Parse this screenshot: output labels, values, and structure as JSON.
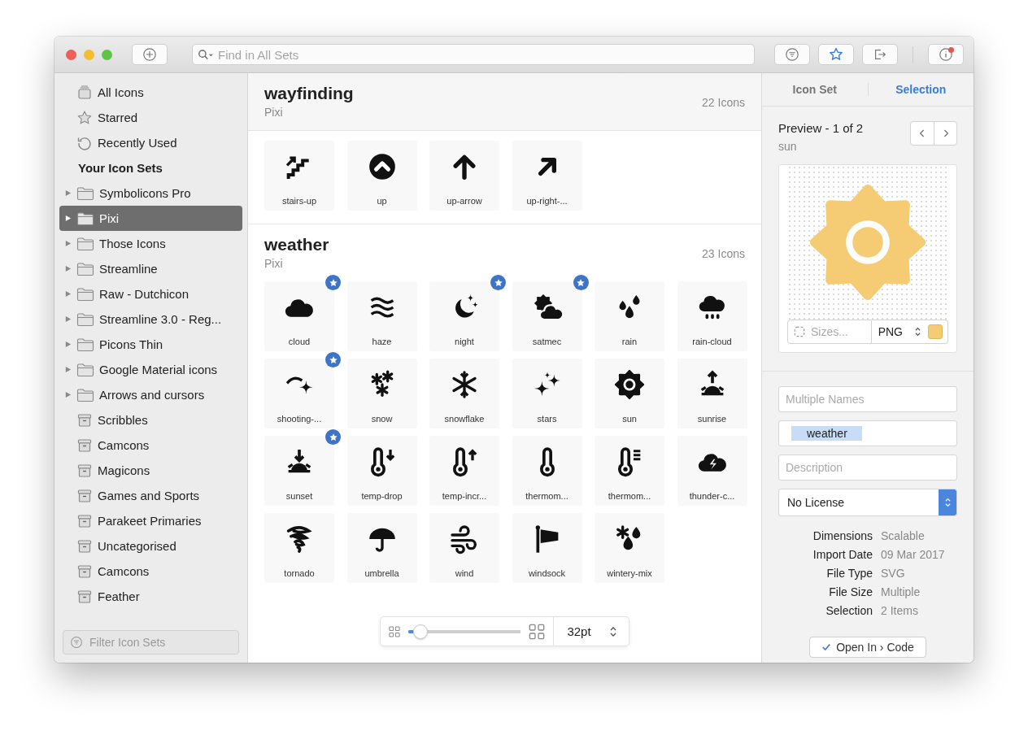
{
  "toolbar": {
    "search": {
      "placeholder": "Find in All Sets"
    },
    "notification": true
  },
  "sidebar": {
    "items": [
      {
        "label": "All Icons",
        "kind": "library",
        "selected": false
      },
      {
        "label": "Starred",
        "kind": "star",
        "selected": false
      },
      {
        "label": "Recently Used",
        "kind": "recent",
        "selected": false
      },
      {
        "label": "Your Icon Sets",
        "kind": "heading"
      },
      {
        "label": "Symbolicons Pro",
        "kind": "folder",
        "selected": false
      },
      {
        "label": "Pixi",
        "kind": "folder",
        "selected": true
      },
      {
        "label": "Those Icons",
        "kind": "folder",
        "selected": false
      },
      {
        "label": "Streamline",
        "kind": "folder",
        "selected": false
      },
      {
        "label": "Raw - Dutchicon",
        "kind": "folder",
        "selected": false
      },
      {
        "label": "Streamline 3.0 - Reg...",
        "kind": "folder",
        "selected": false
      },
      {
        "label": "Picons Thin",
        "kind": "folder",
        "selected": false
      },
      {
        "label": "Google Material icons",
        "kind": "folder",
        "selected": false
      },
      {
        "label": "Arrows and cursors",
        "kind": "folder",
        "selected": false
      },
      {
        "label": "Scribbles",
        "kind": "archive",
        "selected": false
      },
      {
        "label": "Camcons",
        "kind": "archive",
        "selected": false
      },
      {
        "label": "Magicons",
        "kind": "archive",
        "selected": false
      },
      {
        "label": "Games and Sports",
        "kind": "archive",
        "selected": false
      },
      {
        "label": "Parakeet Primaries",
        "kind": "archive",
        "selected": false
      },
      {
        "label": "Uncategorised",
        "kind": "archive",
        "selected": false
      },
      {
        "label": "Camcons",
        "kind": "archive",
        "selected": false
      },
      {
        "label": "Feather",
        "kind": "archive",
        "selected": false
      }
    ],
    "filter": {
      "placeholder": "Filter Icon Sets"
    }
  },
  "sections": [
    {
      "title": "wayfinding",
      "set": "Pixi",
      "count": "22 Icons",
      "shaded": true,
      "icons": [
        {
          "label": "stairs-up",
          "kind": "stairs",
          "starred": false
        },
        {
          "label": "up",
          "kind": "circle-up",
          "starred": false
        },
        {
          "label": "up-arrow",
          "kind": "arrow-up",
          "starred": false
        },
        {
          "label": "up-right-...",
          "kind": "arrow-up-right",
          "starred": false
        }
      ]
    },
    {
      "title": "weather",
      "set": "Pixi",
      "count": "23 Icons",
      "shaded": false,
      "icons": [
        {
          "label": "cloud",
          "kind": "cloud",
          "starred": true
        },
        {
          "label": "haze",
          "kind": "haze",
          "starred": false
        },
        {
          "label": "night",
          "kind": "moon",
          "starred": true
        },
        {
          "label": "satmec",
          "kind": "sun-cloud",
          "starred": true
        },
        {
          "label": "rain",
          "kind": "rain",
          "starred": false
        },
        {
          "label": "rain-cloud",
          "kind": "rain-cloud",
          "starred": false
        },
        {
          "label": "shooting-...",
          "kind": "shooting-star",
          "starred": true
        },
        {
          "label": "snow",
          "kind": "snow",
          "starred": false
        },
        {
          "label": "snowflake",
          "kind": "snowflake",
          "starred": false
        },
        {
          "label": "stars",
          "kind": "stars",
          "starred": false
        },
        {
          "label": "sun",
          "kind": "sun",
          "starred": false
        },
        {
          "label": "sunrise",
          "kind": "sunrise",
          "starred": false
        },
        {
          "label": "sunset",
          "kind": "sunset",
          "starred": true
        },
        {
          "label": "temp-drop",
          "kind": "temp-down",
          "starred": false
        },
        {
          "label": "temp-incr...",
          "kind": "temp-up",
          "starred": false
        },
        {
          "label": "thermom...",
          "kind": "thermometer",
          "starred": false
        },
        {
          "label": "thermom...",
          "kind": "thermometer-scale",
          "starred": false
        },
        {
          "label": "thunder-c...",
          "kind": "thunder-cloud",
          "starred": false
        },
        {
          "label": "tornado",
          "kind": "tornado",
          "starred": false
        },
        {
          "label": "umbrella",
          "kind": "umbrella",
          "starred": false
        },
        {
          "label": "wind",
          "kind": "wind",
          "starred": false
        },
        {
          "label": "windsock",
          "kind": "windsock",
          "starred": false
        },
        {
          "label": "wintery-mix",
          "kind": "wintry-mix",
          "starred": false
        }
      ]
    }
  ],
  "size_control": {
    "level": 0.05,
    "size": "32pt"
  },
  "inspector": {
    "tabs": [
      {
        "label": "Icon Set",
        "selected": false
      },
      {
        "label": "Selection",
        "selected": true
      }
    ],
    "preview_title": "Preview - 1 of 2",
    "preview_name": "sun",
    "sizes": {
      "placeholder": "Sizes..."
    },
    "format": "PNG",
    "names": {
      "placeholder": "Multiple Names"
    },
    "tags": [
      "weather"
    ],
    "description": {
      "placeholder": "Description"
    },
    "license": "No License",
    "properties": [
      {
        "label": "Dimensions",
        "value": "Scalable"
      },
      {
        "label": "Import Date",
        "value": "09 Mar 2017"
      },
      {
        "label": "File Type",
        "value": "SVG"
      },
      {
        "label": "File Size",
        "value": "Multiple"
      },
      {
        "label": "Selection",
        "value": "2 Items"
      }
    ],
    "open_button": "Open In › Code"
  }
}
